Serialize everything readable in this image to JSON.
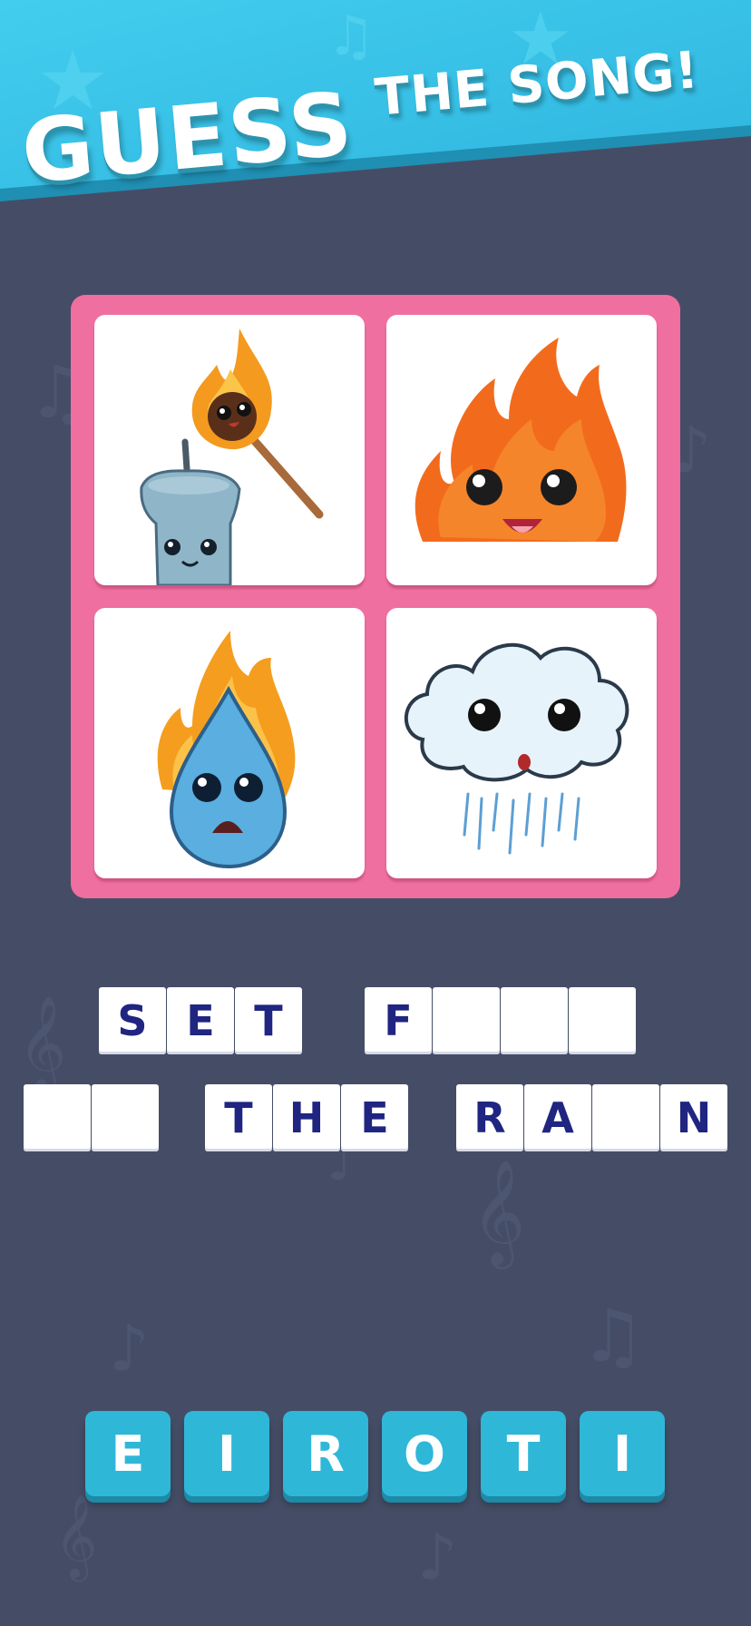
{
  "header": {
    "title_main": "GUESS",
    "title_rest": "THE SONG!"
  },
  "puzzle": {
    "images": [
      {
        "icon": "candle-and-match-icon"
      },
      {
        "icon": "fire-icon"
      },
      {
        "icon": "burning-water-drop-icon"
      },
      {
        "icon": "rain-cloud-icon"
      }
    ]
  },
  "answer": {
    "row1": [
      "S",
      "E",
      "T",
      "",
      "F",
      "",
      "",
      ""
    ],
    "row2": [
      "",
      "",
      "T",
      "H",
      "E",
      "R",
      "A",
      "",
      "N"
    ]
  },
  "choices": [
    "E",
    "I",
    "R",
    "O",
    "T",
    "I"
  ],
  "colors": {
    "background": "#454d66",
    "banner": "#3cc3e6",
    "grid_frame": "#ef6fa0",
    "letter_text": "#1f2580",
    "choice_tile": "#2fb7d8"
  }
}
